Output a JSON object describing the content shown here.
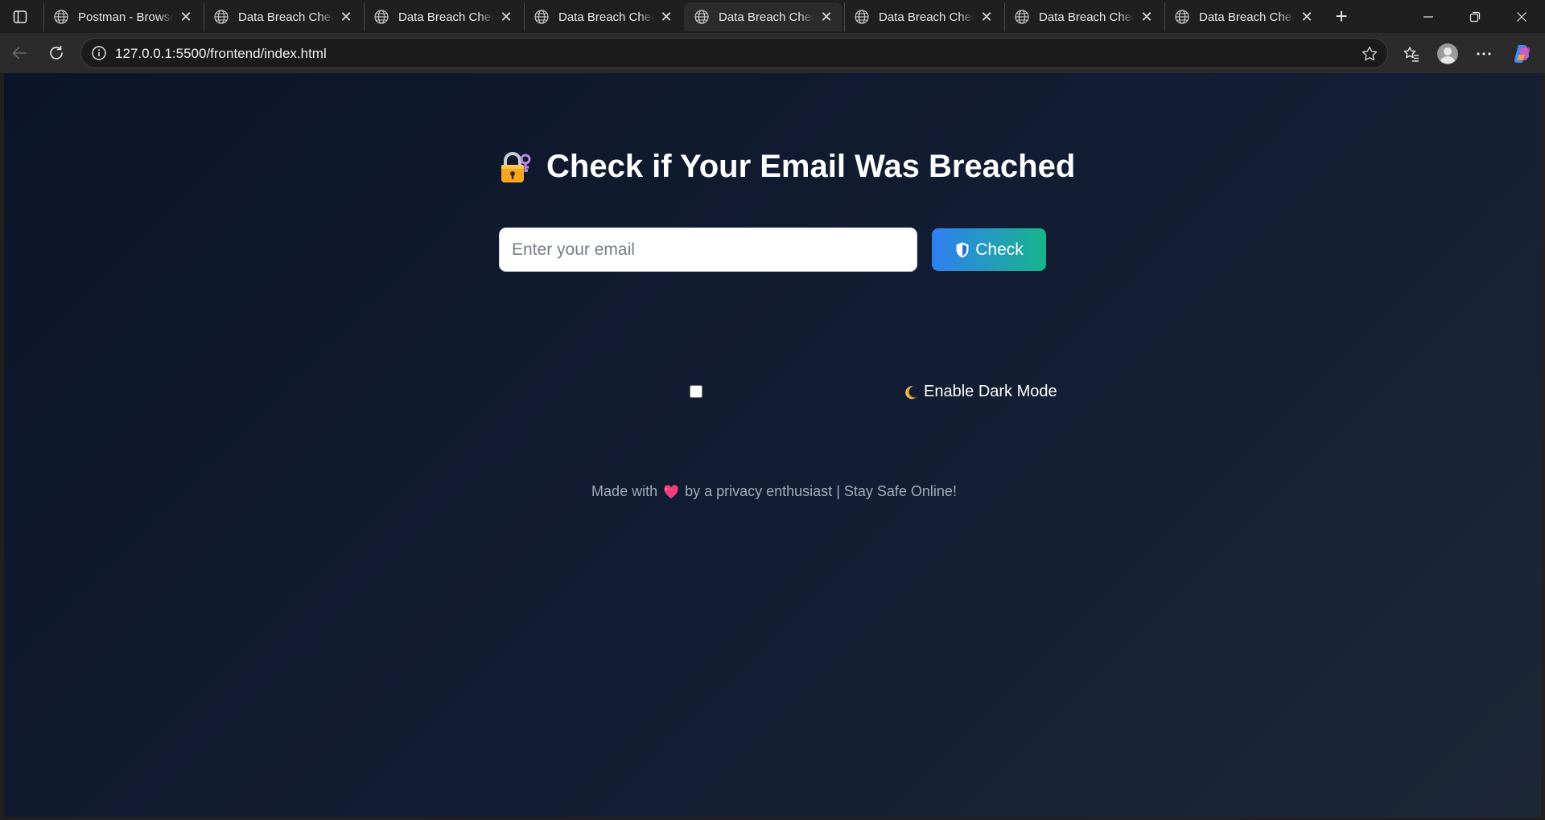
{
  "browser": {
    "tabs": [
      {
        "title": "Postman - Browser",
        "active": false
      },
      {
        "title": "Data Breach Checker",
        "active": false
      },
      {
        "title": "Data Breach Checker",
        "active": false
      },
      {
        "title": "Data Breach Checker",
        "active": false
      },
      {
        "title": "Data Breach Checker",
        "active": true
      },
      {
        "title": "Data Breach Checker",
        "active": false
      },
      {
        "title": "Data Breach Checker",
        "active": false
      },
      {
        "title": "Data Breach Checker",
        "active": false
      }
    ],
    "new_tab_label": "+",
    "close_glyph": "✕",
    "address": "127.0.0.1:5500/frontend/index.html"
  },
  "page": {
    "heading_text": "Check if Your Email Was Breached",
    "heading_icon": "lock-with-key-icon",
    "email_placeholder": "Enter your email",
    "email_value": "",
    "check_label": "Check",
    "check_icon": "shield-icon",
    "dark_mode_checked": false,
    "dark_mode_label": "Enable Dark Mode",
    "dark_mode_icon": "moon-icon",
    "footer_before": "Made with",
    "footer_after": "by a privacy enthusiast | Stay Safe Online!",
    "footer_icon": "heart-icon"
  },
  "colors": {
    "accent_start": "#2f7ff2",
    "accent_end": "#18b58a",
    "page_bg": "#0c1528",
    "footer_text": "#a3acbb"
  }
}
